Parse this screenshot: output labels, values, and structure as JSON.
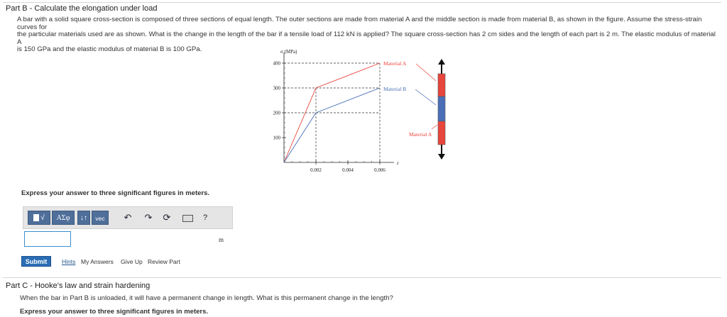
{
  "partB": {
    "title_prefix": "Part B",
    "title_sep": " - ",
    "title": "Calculate the elongation under load",
    "problem_line1": "A bar with a solid square cross-section is composed of three sections of equal length. The outer sections are made from material A and the middle section is made from material B, as shown in the figure. Assume the stress-strain curves for",
    "problem_line2": "the particular materials used are as shown. What is the change in the length of the bar if a tensile load of 112 kN is applied? The square cross-section has 2 cm sides and the length of each part is 2 m. The elastic modulus of material A",
    "problem_line3": "is 150 GPa and the elastic modulus of material B is 100 GPa.",
    "prompt": "Express your answer to three significant figures in meters.",
    "unit": "m"
  },
  "toolbar": {
    "sqrt_label": "√",
    "greek_label": "ΑΣφ",
    "sort_label": "↓↑",
    "vec_label": "vec",
    "undo_icon": "undo-icon",
    "redo_icon": "redo-icon",
    "reset_icon": "reset-icon",
    "keyboard_icon": "keyboard-icon",
    "help_label": "?"
  },
  "answer": {
    "value": ""
  },
  "actions": {
    "submit": "Submit",
    "hints": "Hints",
    "my_answers": "My Answers",
    "give_up": "Give Up",
    "review_part": "Review Part"
  },
  "partC": {
    "title_prefix": "Part C",
    "title_sep": " - ",
    "title": "Hooke's law and strain hardening",
    "question": "When the bar in Part B is unloaded, it will have a permanent change in length. What is this permanent change in the length?",
    "prompt": "Express your answer to three significant figures in meters."
  },
  "figure": {
    "y_axis_label": "σ (MPa)",
    "x_axis_label": "ε",
    "material_a_label": "Material A",
    "material_b_label": "Material B",
    "material_a_bar_label": "Material A",
    "colors": {
      "material_a": "#e8463c",
      "material_b": "#4a6fb8",
      "dashed": "#333333"
    }
  },
  "chart_data": {
    "type": "line",
    "xlabel": "ε",
    "ylabel": "σ (MPa)",
    "x_ticks": [
      "0.002",
      "0.004",
      "0.006"
    ],
    "y_ticks": [
      "100",
      "200",
      "300",
      "400"
    ],
    "xlim": [
      0,
      0.0065
    ],
    "ylim": [
      0,
      430
    ],
    "series": [
      {
        "name": "Material A",
        "points": [
          [
            0,
            0
          ],
          [
            0.002,
            300
          ],
          [
            0.006,
            400
          ]
        ]
      },
      {
        "name": "Material B",
        "points": [
          [
            0,
            0
          ],
          [
            0.002,
            200
          ],
          [
            0.006,
            300
          ]
        ]
      }
    ]
  }
}
